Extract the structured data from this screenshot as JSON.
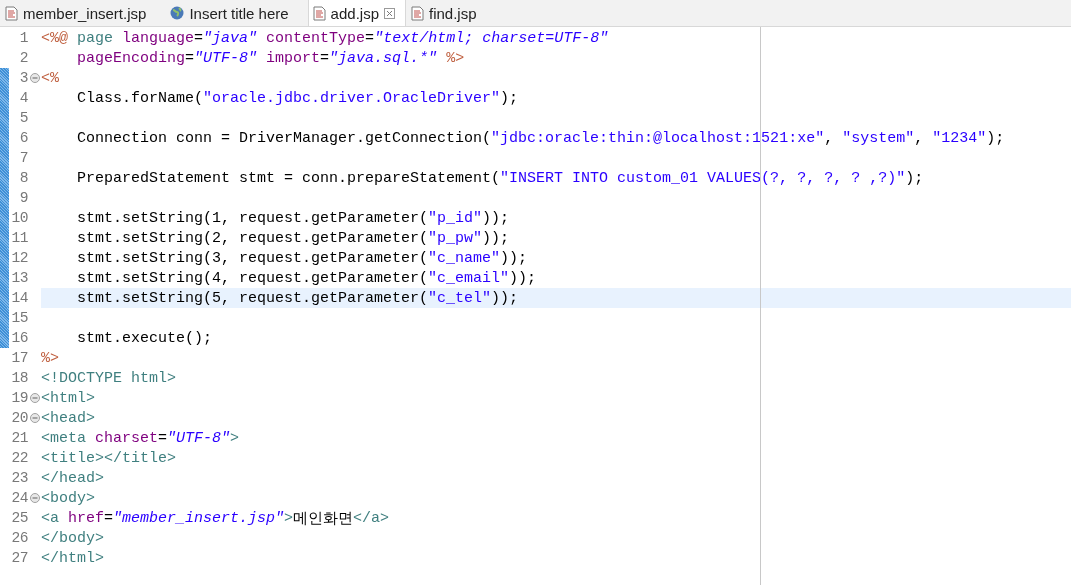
{
  "tabs": [
    {
      "label": "member_insert.jsp",
      "kind": "file",
      "selected": false,
      "closable": false
    },
    {
      "label": "Insert title here",
      "kind": "web",
      "selected": false,
      "closable": false
    },
    {
      "label": "add.jsp",
      "kind": "file",
      "selected": true,
      "closable": true
    },
    {
      "label": "find.jsp",
      "kind": "file",
      "selected": false,
      "closable": false
    }
  ],
  "editor": {
    "lines": [
      {
        "number": "1",
        "foldable": false,
        "changed": false,
        "current": false,
        "tokens": [
          {
            "t": "<%@ ",
            "kind": "directive"
          },
          {
            "t": "page ",
            "kind": "tag"
          },
          {
            "t": "language",
            "kind": "attr"
          },
          {
            "t": "=",
            "kind": "plain"
          },
          {
            "t": "\"java\"",
            "kind": "value"
          },
          {
            "t": " contentType",
            "kind": "attr"
          },
          {
            "t": "=",
            "kind": "plain"
          },
          {
            "t": "\"text/html; charset=UTF-8\"",
            "kind": "value"
          }
        ]
      },
      {
        "number": "2",
        "foldable": false,
        "changed": false,
        "current": false,
        "tokens": [
          {
            "t": "    pageEncoding",
            "kind": "attr"
          },
          {
            "t": "=",
            "kind": "plain"
          },
          {
            "t": "\"UTF-8\"",
            "kind": "value"
          },
          {
            "t": " import",
            "kind": "attr"
          },
          {
            "t": "=",
            "kind": "plain"
          },
          {
            "t": "\"java.sql.*\"",
            "kind": "value"
          },
          {
            "t": " %>",
            "kind": "directive"
          }
        ]
      },
      {
        "number": "3",
        "foldable": true,
        "changed": true,
        "current": false,
        "tokens": [
          {
            "t": "<%",
            "kind": "directive"
          }
        ]
      },
      {
        "number": "4",
        "foldable": false,
        "changed": true,
        "current": false,
        "tokens": [
          {
            "t": "    Class.forName(",
            "kind": "plain"
          },
          {
            "t": "\"oracle.jdbc.driver.OracleDriver\"",
            "kind": "string"
          },
          {
            "t": ");",
            "kind": "plain"
          }
        ]
      },
      {
        "number": "5",
        "foldable": false,
        "changed": true,
        "current": false
      },
      {
        "number": "6",
        "foldable": false,
        "changed": true,
        "current": false,
        "tokens": [
          {
            "t": "    Connection conn = DriverManager.getConnection(",
            "kind": "plain"
          },
          {
            "t": "\"jdbc:oracle:thin:@localhost:1521:xe\"",
            "kind": "string"
          },
          {
            "t": ", ",
            "kind": "plain"
          },
          {
            "t": "\"system\"",
            "kind": "string"
          },
          {
            "t": ", ",
            "kind": "plain"
          },
          {
            "t": "\"1234\"",
            "kind": "string"
          },
          {
            "t": ");",
            "kind": "plain"
          }
        ]
      },
      {
        "number": "7",
        "foldable": false,
        "changed": true,
        "current": false
      },
      {
        "number": "8",
        "foldable": false,
        "changed": true,
        "current": false,
        "tokens": [
          {
            "t": "    PreparedStatement stmt = conn.prepareStatement(",
            "kind": "plain"
          },
          {
            "t": "\"INSERT INTO custom_01 VALUES(?, ?, ?, ? ,?)\"",
            "kind": "string"
          },
          {
            "t": ");",
            "kind": "plain"
          }
        ]
      },
      {
        "number": "9",
        "foldable": false,
        "changed": true,
        "current": false
      },
      {
        "number": "10",
        "foldable": false,
        "changed": true,
        "current": false,
        "tokens": [
          {
            "t": "    stmt.setString(1, request.getParameter(",
            "kind": "plain"
          },
          {
            "t": "\"p_id\"",
            "kind": "string"
          },
          {
            "t": "));",
            "kind": "plain"
          }
        ]
      },
      {
        "number": "11",
        "foldable": false,
        "changed": true,
        "current": false,
        "tokens": [
          {
            "t": "    stmt.setString(2, request.getParameter(",
            "kind": "plain"
          },
          {
            "t": "\"p_pw\"",
            "kind": "string"
          },
          {
            "t": "));",
            "kind": "plain"
          }
        ]
      },
      {
        "number": "12",
        "foldable": false,
        "changed": true,
        "current": false,
        "tokens": [
          {
            "t": "    stmt.setString(3, request.getParameter(",
            "kind": "plain"
          },
          {
            "t": "\"c_name\"",
            "kind": "string"
          },
          {
            "t": "));",
            "kind": "plain"
          }
        ]
      },
      {
        "number": "13",
        "foldable": false,
        "changed": true,
        "current": false,
        "tokens": [
          {
            "t": "    stmt.setString(4, request.getParameter(",
            "kind": "plain"
          },
          {
            "t": "\"c_email\"",
            "kind": "string"
          },
          {
            "t": "));",
            "kind": "plain"
          }
        ]
      },
      {
        "number": "14",
        "foldable": false,
        "changed": true,
        "current": true,
        "tokens": [
          {
            "t": "    stmt.setString(5, request.getParameter(",
            "kind": "plain"
          },
          {
            "t": "\"c_tel\"",
            "kind": "string"
          },
          {
            "t": "));",
            "kind": "plain"
          }
        ]
      },
      {
        "number": "15",
        "foldable": false,
        "changed": true,
        "current": false
      },
      {
        "number": "16",
        "foldable": false,
        "changed": true,
        "current": false,
        "tokens": [
          {
            "t": "    stmt.execute();",
            "kind": "plain"
          }
        ]
      },
      {
        "number": "17",
        "foldable": false,
        "changed": false,
        "current": false,
        "tokens": [
          {
            "t": "%>",
            "kind": "directive"
          }
        ]
      },
      {
        "number": "18",
        "foldable": false,
        "changed": false,
        "current": false,
        "tokens": [
          {
            "t": "<!DOCTYPE html>",
            "kind": "tag"
          }
        ]
      },
      {
        "number": "19",
        "foldable": true,
        "changed": false,
        "current": false,
        "tokens": [
          {
            "t": "<html>",
            "kind": "tag"
          }
        ]
      },
      {
        "number": "20",
        "foldable": true,
        "changed": false,
        "current": false,
        "tokens": [
          {
            "t": "<head>",
            "kind": "tag"
          }
        ]
      },
      {
        "number": "21",
        "foldable": false,
        "changed": false,
        "current": false,
        "tokens": [
          {
            "t": "<meta ",
            "kind": "tag"
          },
          {
            "t": "charset",
            "kind": "attr"
          },
          {
            "t": "=",
            "kind": "plain"
          },
          {
            "t": "\"UTF-8\"",
            "kind": "value"
          },
          {
            "t": ">",
            "kind": "tag"
          }
        ]
      },
      {
        "number": "22",
        "foldable": false,
        "changed": false,
        "current": false,
        "tokens": [
          {
            "t": "<title></title>",
            "kind": "tag"
          }
        ]
      },
      {
        "number": "23",
        "foldable": false,
        "changed": false,
        "current": false,
        "tokens": [
          {
            "t": "</head>",
            "kind": "tag"
          }
        ]
      },
      {
        "number": "24",
        "foldable": true,
        "changed": false,
        "current": false,
        "tokens": [
          {
            "t": "<body>",
            "kind": "tag"
          }
        ]
      },
      {
        "number": "25",
        "foldable": false,
        "changed": false,
        "current": false,
        "tokens": [
          {
            "t": "<a ",
            "kind": "tag"
          },
          {
            "t": "href",
            "kind": "attr"
          },
          {
            "t": "=",
            "kind": "plain"
          },
          {
            "t": "\"member_insert.jsp\"",
            "kind": "value"
          },
          {
            "t": ">",
            "kind": "tag"
          },
          {
            "t": "메인화면",
            "kind": "plain"
          },
          {
            "t": "</a>",
            "kind": "tag"
          }
        ]
      },
      {
        "number": "26",
        "foldable": false,
        "changed": false,
        "current": false,
        "tokens": [
          {
            "t": "</body>",
            "kind": "tag"
          }
        ]
      },
      {
        "number": "27",
        "foldable": false,
        "changed": false,
        "current": false,
        "tokens": [
          {
            "t": "</html>",
            "kind": "tag"
          }
        ]
      }
    ]
  }
}
